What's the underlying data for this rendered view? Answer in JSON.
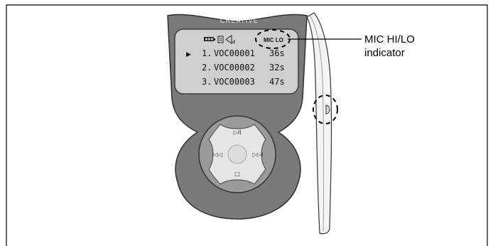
{
  "device": {
    "brand": "CREATIVE",
    "mic_level_badge": "MIC LO",
    "selection_marker": "▶",
    "recordings": [
      {
        "index": "1.",
        "name": "VOC00001",
        "duration": "36s"
      },
      {
        "index": "2.",
        "name": "VOC00002",
        "duration": "32s"
      },
      {
        "index": "3.",
        "name": "VOC00003",
        "duration": "47s"
      }
    ],
    "buttons": {
      "play_pause": "▷II",
      "previous": "I◁◁",
      "next": "▷▷I",
      "stop": "□"
    }
  },
  "callout": {
    "line1": "MIC HI/LO",
    "line2": "indicator"
  },
  "colors": {
    "body": "#7a7a7a",
    "lcd": "#cfcfcf",
    "dpad": "#e6e6e6",
    "side_panel": "#f4f4f4"
  }
}
